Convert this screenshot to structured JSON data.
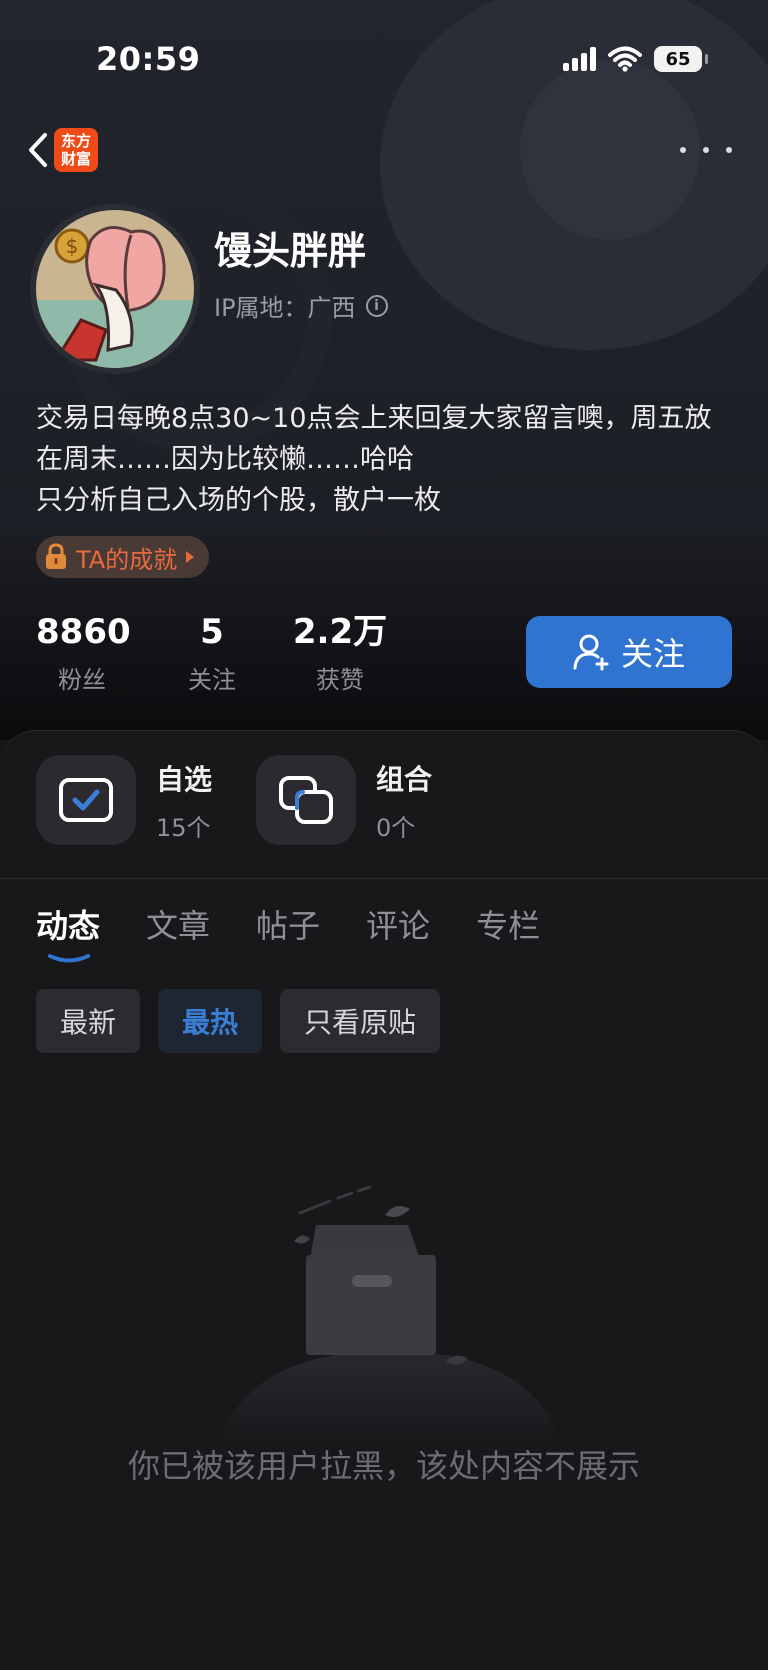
{
  "status_bar": {
    "time": "20:59",
    "battery": "65"
  },
  "nav": {
    "brand_line1": "东方",
    "brand_line2": "财富"
  },
  "profile": {
    "name": "馒头胖胖",
    "ip_location": "IP属地：广西",
    "bio_lines": [
      "交易日每晚8点30~10点会上来回复大家留言噢，周五放",
      "在周末……因为比较懒……哈哈",
      "只分析自己入场的个股，散户一枚"
    ],
    "achievement_label": "TA的成就"
  },
  "stats": [
    {
      "value": "8860",
      "label": "粉丝"
    },
    {
      "value": "5",
      "label": "关注"
    },
    {
      "value": "2.2万",
      "label": "获赞"
    }
  ],
  "follow_button": "关注",
  "quick_entries": [
    {
      "title": "自选",
      "count": "15个"
    },
    {
      "title": "组合",
      "count": "0个"
    }
  ],
  "tabs": [
    "动态",
    "文章",
    "帖子",
    "评论",
    "专栏"
  ],
  "active_tab": "动态",
  "filters": [
    "最新",
    "最热",
    "只看原贴"
  ],
  "active_filter": "最热",
  "empty_message": "你已被该用户拉黑，该处内容不展示",
  "colors": {
    "accent": "#2f74d0",
    "brand": "#ee4b18",
    "achievement": "#e66a3d"
  }
}
